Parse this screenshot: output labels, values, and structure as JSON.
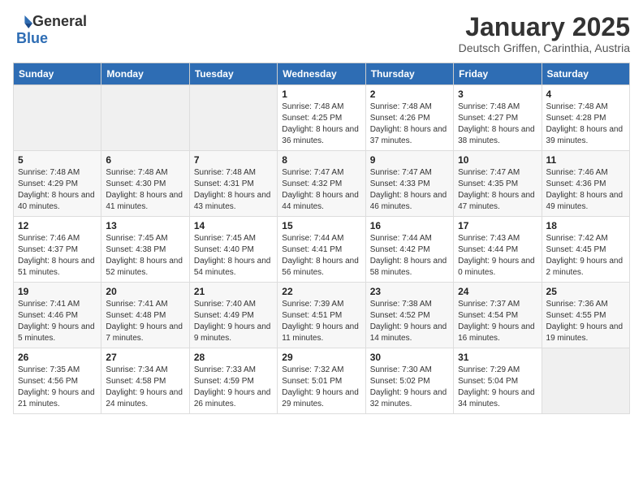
{
  "header": {
    "logo_general": "General",
    "logo_blue": "Blue",
    "title": "January 2025",
    "subtitle": "Deutsch Griffen, Carinthia, Austria"
  },
  "calendar": {
    "days_of_week": [
      "Sunday",
      "Monday",
      "Tuesday",
      "Wednesday",
      "Thursday",
      "Friday",
      "Saturday"
    ],
    "weeks": [
      [
        {
          "day": "",
          "info": ""
        },
        {
          "day": "",
          "info": ""
        },
        {
          "day": "",
          "info": ""
        },
        {
          "day": "1",
          "info": "Sunrise: 7:48 AM\nSunset: 4:25 PM\nDaylight: 8 hours and 36 minutes."
        },
        {
          "day": "2",
          "info": "Sunrise: 7:48 AM\nSunset: 4:26 PM\nDaylight: 8 hours and 37 minutes."
        },
        {
          "day": "3",
          "info": "Sunrise: 7:48 AM\nSunset: 4:27 PM\nDaylight: 8 hours and 38 minutes."
        },
        {
          "day": "4",
          "info": "Sunrise: 7:48 AM\nSunset: 4:28 PM\nDaylight: 8 hours and 39 minutes."
        }
      ],
      [
        {
          "day": "5",
          "info": "Sunrise: 7:48 AM\nSunset: 4:29 PM\nDaylight: 8 hours and 40 minutes."
        },
        {
          "day": "6",
          "info": "Sunrise: 7:48 AM\nSunset: 4:30 PM\nDaylight: 8 hours and 41 minutes."
        },
        {
          "day": "7",
          "info": "Sunrise: 7:48 AM\nSunset: 4:31 PM\nDaylight: 8 hours and 43 minutes."
        },
        {
          "day": "8",
          "info": "Sunrise: 7:47 AM\nSunset: 4:32 PM\nDaylight: 8 hours and 44 minutes."
        },
        {
          "day": "9",
          "info": "Sunrise: 7:47 AM\nSunset: 4:33 PM\nDaylight: 8 hours and 46 minutes."
        },
        {
          "day": "10",
          "info": "Sunrise: 7:47 AM\nSunset: 4:35 PM\nDaylight: 8 hours and 47 minutes."
        },
        {
          "day": "11",
          "info": "Sunrise: 7:46 AM\nSunset: 4:36 PM\nDaylight: 8 hours and 49 minutes."
        }
      ],
      [
        {
          "day": "12",
          "info": "Sunrise: 7:46 AM\nSunset: 4:37 PM\nDaylight: 8 hours and 51 minutes."
        },
        {
          "day": "13",
          "info": "Sunrise: 7:45 AM\nSunset: 4:38 PM\nDaylight: 8 hours and 52 minutes."
        },
        {
          "day": "14",
          "info": "Sunrise: 7:45 AM\nSunset: 4:40 PM\nDaylight: 8 hours and 54 minutes."
        },
        {
          "day": "15",
          "info": "Sunrise: 7:44 AM\nSunset: 4:41 PM\nDaylight: 8 hours and 56 minutes."
        },
        {
          "day": "16",
          "info": "Sunrise: 7:44 AM\nSunset: 4:42 PM\nDaylight: 8 hours and 58 minutes."
        },
        {
          "day": "17",
          "info": "Sunrise: 7:43 AM\nSunset: 4:44 PM\nDaylight: 9 hours and 0 minutes."
        },
        {
          "day": "18",
          "info": "Sunrise: 7:42 AM\nSunset: 4:45 PM\nDaylight: 9 hours and 2 minutes."
        }
      ],
      [
        {
          "day": "19",
          "info": "Sunrise: 7:41 AM\nSunset: 4:46 PM\nDaylight: 9 hours and 5 minutes."
        },
        {
          "day": "20",
          "info": "Sunrise: 7:41 AM\nSunset: 4:48 PM\nDaylight: 9 hours and 7 minutes."
        },
        {
          "day": "21",
          "info": "Sunrise: 7:40 AM\nSunset: 4:49 PM\nDaylight: 9 hours and 9 minutes."
        },
        {
          "day": "22",
          "info": "Sunrise: 7:39 AM\nSunset: 4:51 PM\nDaylight: 9 hours and 11 minutes."
        },
        {
          "day": "23",
          "info": "Sunrise: 7:38 AM\nSunset: 4:52 PM\nDaylight: 9 hours and 14 minutes."
        },
        {
          "day": "24",
          "info": "Sunrise: 7:37 AM\nSunset: 4:54 PM\nDaylight: 9 hours and 16 minutes."
        },
        {
          "day": "25",
          "info": "Sunrise: 7:36 AM\nSunset: 4:55 PM\nDaylight: 9 hours and 19 minutes."
        }
      ],
      [
        {
          "day": "26",
          "info": "Sunrise: 7:35 AM\nSunset: 4:56 PM\nDaylight: 9 hours and 21 minutes."
        },
        {
          "day": "27",
          "info": "Sunrise: 7:34 AM\nSunset: 4:58 PM\nDaylight: 9 hours and 24 minutes."
        },
        {
          "day": "28",
          "info": "Sunrise: 7:33 AM\nSunset: 4:59 PM\nDaylight: 9 hours and 26 minutes."
        },
        {
          "day": "29",
          "info": "Sunrise: 7:32 AM\nSunset: 5:01 PM\nDaylight: 9 hours and 29 minutes."
        },
        {
          "day": "30",
          "info": "Sunrise: 7:30 AM\nSunset: 5:02 PM\nDaylight: 9 hours and 32 minutes."
        },
        {
          "day": "31",
          "info": "Sunrise: 7:29 AM\nSunset: 5:04 PM\nDaylight: 9 hours and 34 minutes."
        },
        {
          "day": "",
          "info": ""
        }
      ]
    ]
  }
}
